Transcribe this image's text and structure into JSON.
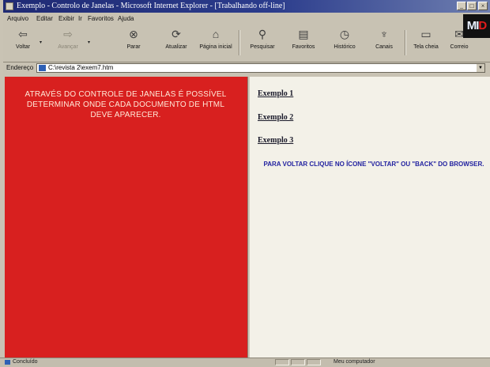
{
  "window": {
    "title": "Exemplo - Controlo de Janelas - Microsoft Internet Explorer - [Trabalhando off-line]",
    "buttons": {
      "minimize": "_",
      "maximize": "□",
      "close": "×"
    }
  },
  "menu": [
    "Arquivo",
    "Editar",
    "Exibir",
    "Ir",
    "Favoritos",
    "Ajuda"
  ],
  "logo": {
    "text_a": "MI",
    "text_b": "D"
  },
  "toolbar": [
    {
      "label": "Voltar",
      "icon": "back-arrow-icon",
      "glyph": "⇦",
      "enabled": true
    },
    {
      "label": "Avançar",
      "icon": "forward-arrow-icon",
      "glyph": "⇨",
      "enabled": false
    },
    {
      "label": "Parar",
      "icon": "stop-icon",
      "glyph": "⊗",
      "enabled": true
    },
    {
      "label": "Atualizar",
      "icon": "refresh-icon",
      "glyph": "⟳",
      "enabled": true
    },
    {
      "label": "Página inicial",
      "icon": "home-icon",
      "glyph": "⌂",
      "enabled": true
    },
    {
      "label": "Pesquisar",
      "icon": "search-icon",
      "glyph": "⚲",
      "enabled": true
    },
    {
      "label": "Favoritos",
      "icon": "favorites-icon",
      "glyph": "▤",
      "enabled": true
    },
    {
      "label": "Histórico",
      "icon": "history-icon",
      "glyph": "◷",
      "enabled": true
    },
    {
      "label": "Canais",
      "icon": "channels-icon",
      "glyph": "♆",
      "enabled": true
    },
    {
      "label": "Tela cheia",
      "icon": "fullscreen-icon",
      "glyph": "▭",
      "enabled": true
    },
    {
      "label": "Correio",
      "icon": "mail-icon",
      "glyph": "✉",
      "enabled": true
    }
  ],
  "address": {
    "label": "Endereço",
    "value": "C:\\revista 2\\exem7.htm"
  },
  "left_frame": {
    "text": "ATRAVÉS DO CONTROLE DE JANELAS É POSSÍVEL DETERMINAR ONDE CADA DOCUMENTO DE HTML DEVE APARECER.",
    "bg_color": "#d8201f"
  },
  "right_frame": {
    "links": [
      "Exemplo 1",
      "Exemplo 2",
      "Exemplo 3"
    ],
    "instructions": "PARA VOLTAR CLIQUE NO ÍCONE \"VOLTAR\" OU \"BACK\" DO BROWSER."
  },
  "status": {
    "text": "Concluído",
    "zone": "Meu computador"
  }
}
